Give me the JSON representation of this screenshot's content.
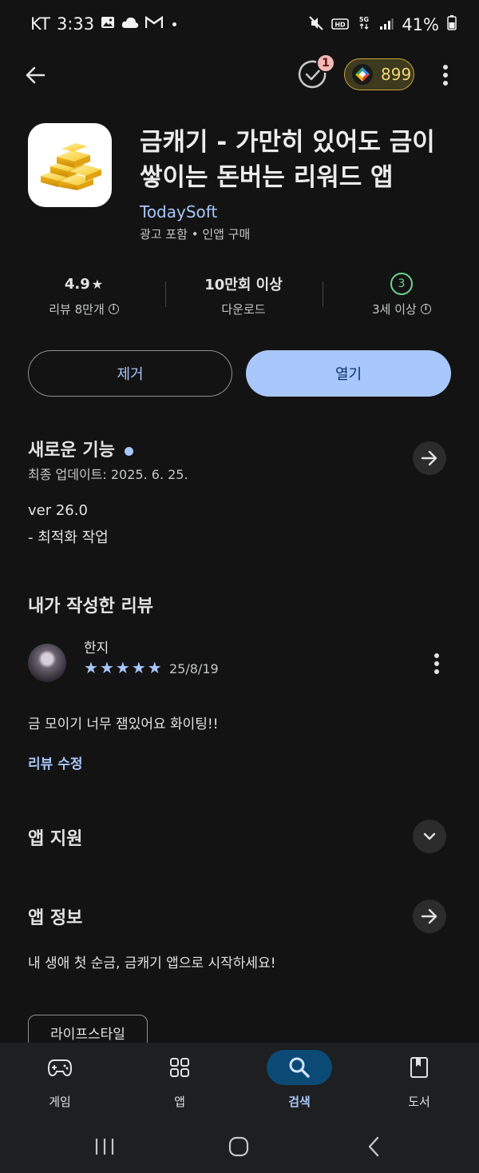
{
  "status_bar": {
    "carrier": "KT",
    "time": "3:33",
    "battery": "41%",
    "left_icons": [
      "gallery-icon",
      "cloud-icon",
      "gmail-icon",
      "dot-icon"
    ],
    "right_icons": [
      "mute-icon",
      "hd-icon",
      "5g-icon",
      "signal-icon",
      "battery-icon"
    ]
  },
  "top_bar": {
    "notification_count": "1",
    "points": "899"
  },
  "app": {
    "title": "금캐기 - 가만히 있어도 금이 쌓이는 돈버는 리워드 앱",
    "developer": "TodaySoft",
    "meta": "광고 포함 • 인앱 구매"
  },
  "stats": {
    "rating": "4.9",
    "rating_label": "리뷰 8만개",
    "downloads": "10만회 이상",
    "downloads_label": "다운로드",
    "age_value": "3",
    "age_label": "3세 이상"
  },
  "buttons": {
    "remove": "제거",
    "open": "열기"
  },
  "whats_new": {
    "title": "새로운 기능",
    "updated": "최종 업데이트: 2025. 6. 25.",
    "version": "ver 26.0",
    "note": "- 최적화 작업"
  },
  "my_review": {
    "title": "내가 작성한 리뷰",
    "author": "한지",
    "stars": 5,
    "date": "25/8/19",
    "text": "금 모이기 너무 잼있어요 화이팅!!",
    "edit_label": "리뷰 수정"
  },
  "app_support": {
    "title": "앱 지원"
  },
  "app_info": {
    "title": "앱 정보",
    "description": "내 생애 첫 순금, 금캐기 앱으로 시작하세요!",
    "category_chip": "라이프스타일"
  },
  "bottom_nav": {
    "items": [
      {
        "label": "게임",
        "icon": "gamepad-icon"
      },
      {
        "label": "앱",
        "icon": "apps-grid-icon"
      },
      {
        "label": "검색",
        "icon": "search-icon"
      },
      {
        "label": "도서",
        "icon": "book-icon"
      }
    ],
    "active": "검색"
  },
  "colors": {
    "background": "#131313",
    "accent": "#a8c7fa",
    "open_button_text": "#062e6f",
    "age_badge": "#6dd58c",
    "points_pill": "#3d3a1d"
  }
}
